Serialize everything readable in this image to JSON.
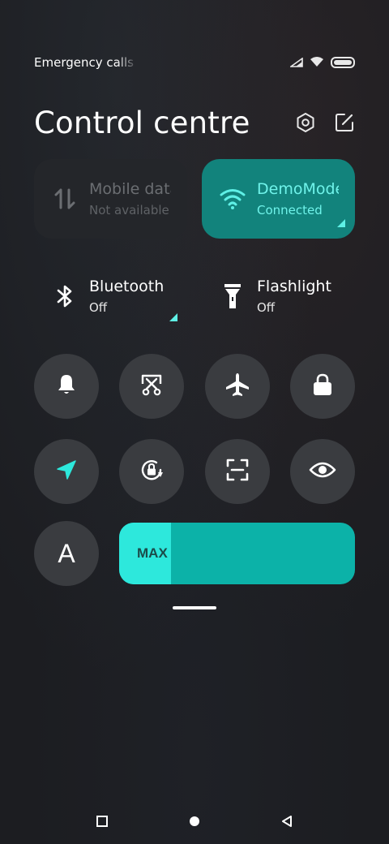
{
  "status_bar": {
    "text": "Emergency calls only",
    "icons": [
      "signal-icon",
      "wifi-icon",
      "battery-icon"
    ]
  },
  "header": {
    "title": "Control centre",
    "actions": [
      "settings-icon",
      "edit-icon"
    ]
  },
  "tiles": {
    "mobile_data": {
      "title": "Mobile data",
      "subtitle": "Not available",
      "icon": "mobile-data-icon"
    },
    "wifi": {
      "title": "DemoMode",
      "subtitle": "Connected",
      "icon": "wifi-icon"
    },
    "bluetooth": {
      "title": "Bluetooth",
      "subtitle": "Off",
      "icon": "bluetooth-icon"
    },
    "flashlight": {
      "title": "Flashlight",
      "subtitle": "Off",
      "icon": "flashlight-icon"
    }
  },
  "toggles_row1": [
    "bell-icon",
    "screenshot-icon",
    "airplane-icon",
    "lock-icon"
  ],
  "toggles_row2": [
    "location-icon",
    "rotation-lock-icon",
    "scanner-icon",
    "eye-icon"
  ],
  "reading_mode": {
    "letter": "A",
    "icon": "auto-brightness-icon"
  },
  "brightness": {
    "label": "MAX",
    "level": 0.22
  },
  "colors": {
    "accent": "#2de8dc",
    "accent_dark": "#0cb2a8",
    "wifi_tile": "#12837c",
    "location_icon": "#2de8dc",
    "button_bg": "#3a3c40",
    "background": "#1c1d21"
  },
  "nav_bar": [
    "recents-button",
    "home-button",
    "back-button"
  ]
}
